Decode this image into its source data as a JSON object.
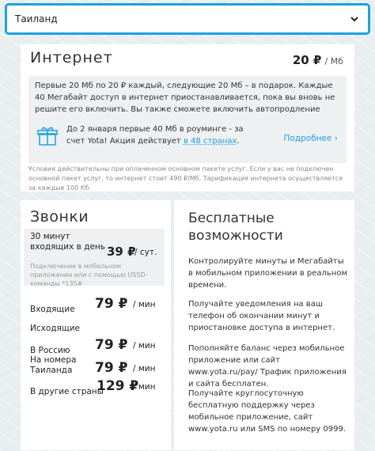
{
  "country_select": {
    "value": "Таиланд"
  },
  "internet": {
    "title": "Интернет",
    "price": "20 ₽",
    "price_unit": "/ Мб",
    "description": "Первые 20 Мб по 20 ₽ каждый, следующие 20 Мб – в подарок. Каждые 40 Мегабайт доступ в интернет приостанавливается, пока вы вновь не решите его включить. Вы также сможете включить автопродление",
    "promo_text": "До 2 января первые 40 Мб в роуминге - за счет Yota! Акция действует ",
    "promo_link": "в 48 странах",
    "promo_end": ".",
    "more_link": "Подробнее ›",
    "note": "Условия действительны при оплаченном основном пакете услуг. Если у вас не подключен основной пакет услуг, то интернет стоит 490 ₽/Мб. Тарификация интернета осуществляется за каждые 100 Кб."
  },
  "calls": {
    "title": "Звонки",
    "package_label": "30 минут входящих в день",
    "package_price": "39 ₽",
    "package_unit": "/ сут.",
    "package_note": "Подключение в мобильном приложении или с помощью USSD-команды *135#",
    "incoming_label": "Входящие",
    "incoming_price": "79 ₽",
    "incoming_unit": "/ мин",
    "outgoing_label": "Исходящие",
    "to_russia_label": "В Россию",
    "to_russia_price": "79 ₽",
    "to_russia_unit": "/ мин",
    "to_thailand_label": "На номера Таиланда",
    "to_thailand_price": "79 ₽",
    "to_thailand_unit": "/ мин",
    "other_label": "В другие страны",
    "other_price": "129 ₽",
    "other_unit": "/ мин"
  },
  "free": {
    "title": "Бесплатные возможности",
    "items": [
      "Контролируйте минуты и Мегабайты в мобильном приложении в реальном времени.",
      "Получайте уведомления на ваш телефон об окончании минут и приостановке доступа в интернет.",
      "Пополняйте баланс через мобильное приложение или сайт www.yota.ru/pay/ Трафик приложения и сайта бесплатен.",
      "Получайте круглосуточную бесплатную поддержку через мобильное приложение, сайт www.yota.ru или SMS по номеру 0999."
    ]
  },
  "colors": {
    "accent": "#1aa3dd",
    "panel": "#eef0f2"
  },
  "icons": {
    "chevron": "chevron-down-icon",
    "gift": "gift-icon"
  }
}
